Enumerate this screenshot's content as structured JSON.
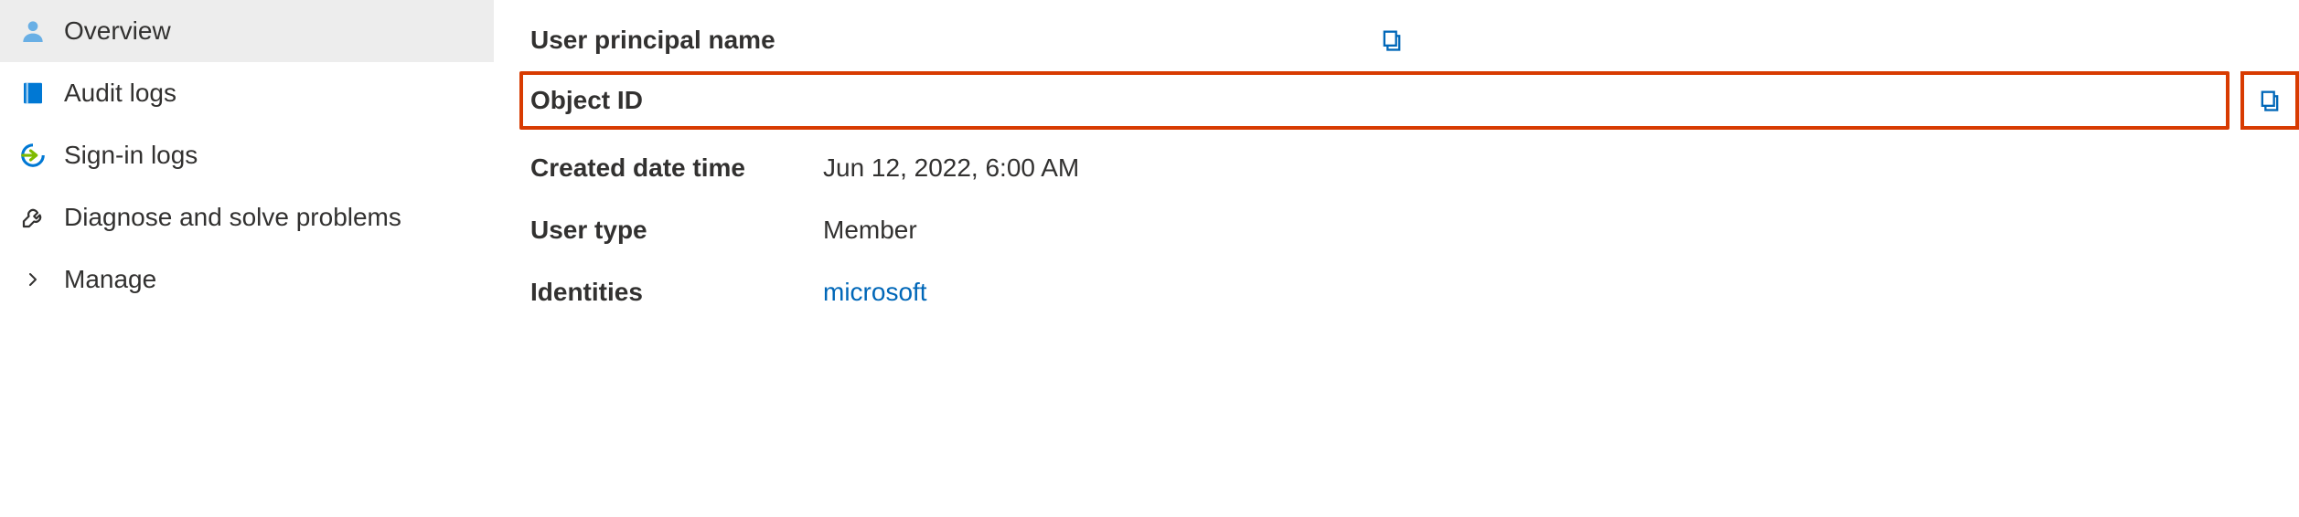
{
  "sidebar": {
    "items": [
      {
        "label": "Overview",
        "icon": "user"
      },
      {
        "label": "Audit logs",
        "icon": "book"
      },
      {
        "label": "Sign-in logs",
        "icon": "signin"
      },
      {
        "label": "Diagnose and solve problems",
        "icon": "wrench"
      },
      {
        "label": "Manage",
        "icon": "chevron-right"
      }
    ]
  },
  "details": {
    "user_principal_name": {
      "label": "User principal name",
      "value": ""
    },
    "object_id": {
      "label": "Object ID",
      "value": ""
    },
    "created_date_time": {
      "label": "Created date time",
      "value": "Jun 12, 2022, 6:00 AM"
    },
    "user_type": {
      "label": "User type",
      "value": "Member"
    },
    "identities": {
      "label": "Identities",
      "value": "microsoft"
    }
  },
  "colors": {
    "highlight": "#d83b01",
    "link": "#0067b8",
    "icon_blue": "#0078d4"
  }
}
